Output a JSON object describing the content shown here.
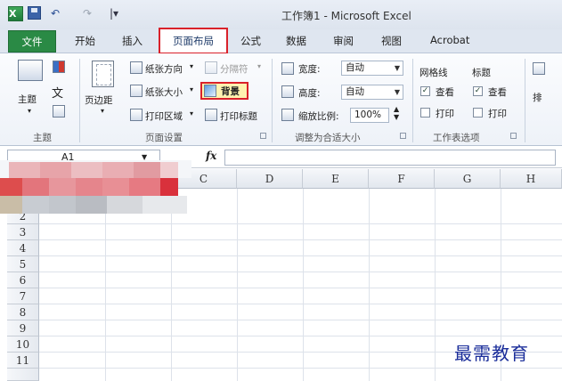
{
  "window": {
    "title": "工作簿1 - Microsoft Excel",
    "qa_undo": "↶",
    "qa_redo": "↷",
    "qa_customize": "|▾"
  },
  "tabs": [
    {
      "label": "文件"
    },
    {
      "label": "开始"
    },
    {
      "label": "插入"
    },
    {
      "label": "页面布局"
    },
    {
      "label": "公式"
    },
    {
      "label": "数据"
    },
    {
      "label": "审阅"
    },
    {
      "label": "视图"
    },
    {
      "label": "Acrobat"
    }
  ],
  "ribbon": {
    "themes_group": {
      "theme_label": "主题",
      "group_name": "主题"
    },
    "page_setup": {
      "margins_label": "页边距",
      "orientation_label": "纸张方向",
      "size_label": "纸张大小",
      "print_area_label": "打印区域",
      "breaks_label": "分隔符",
      "background_label": "背景",
      "print_titles_label": "打印标题",
      "group_name": "页面设置"
    },
    "scale_to_fit": {
      "width_label": "宽度:",
      "width_value": "自动",
      "height_label": "高度:",
      "height_value": "自动",
      "scale_label": "缩放比例:",
      "scale_value": "100%",
      "group_name": "调整为合适大小"
    },
    "sheet_options": {
      "gridlines_label": "网格线",
      "headings_label": "标题",
      "view_label": "查看",
      "print_label": "打印",
      "group_name": "工作表选项",
      "arrange_partial": "排"
    }
  },
  "formula_bar": {
    "name_box": "A1",
    "fx": "fx"
  },
  "grid": {
    "columns": [
      "C",
      "D",
      "E",
      "F",
      "G",
      "H"
    ],
    "rows": [
      "2",
      "3",
      "4",
      "5",
      "6",
      "7",
      "8",
      "9",
      "10",
      "11"
    ]
  },
  "watermark": "最需教育",
  "colors": {
    "file_tab": "#2a8a45",
    "highlight_border": "#d9212a",
    "watermark": "#1a2d9a"
  }
}
